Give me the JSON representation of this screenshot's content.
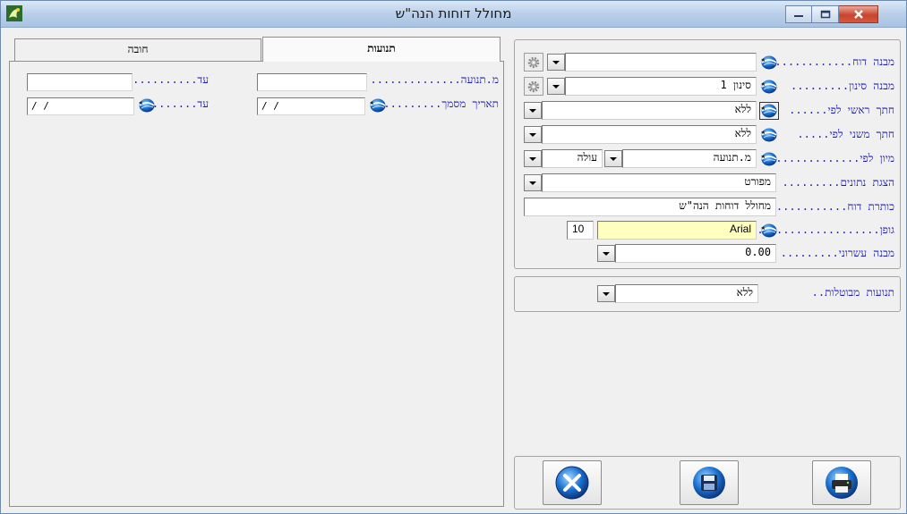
{
  "window": {
    "title": "מחולל דוחות הנה\"ש",
    "icon": "app-logo-icon",
    "controls": [
      "minimize-icon",
      "maximize-icon",
      "close-icon"
    ]
  },
  "left_panel": {
    "tabs": [
      {
        "label": "תנועות",
        "active": true
      },
      {
        "label": "חובה",
        "active": false
      }
    ],
    "fields": {
      "movement_no_label": "מ.תנועה..............",
      "movement_no_value": "",
      "movement_to_label": "עד............",
      "movement_to_value": "",
      "doc_date_label": "תאריך מסמך..........",
      "doc_date_value": "/ /",
      "doc_date_to_label": "עד.......",
      "doc_date_to_value": "/ /"
    }
  },
  "right_panel": {
    "rows": {
      "report_structure_label": "מבנה דוח.............",
      "report_structure_value": "",
      "filter_structure_label": "מבנה סינון.........",
      "filter_structure_value": "סינון 1",
      "primary_section_label": "חתך ראשי לפי......",
      "primary_section_value": "ללא",
      "secondary_section_label": "חתך משני לפי.....",
      "secondary_section_value": "ללא",
      "sort_label": "מיון לפי..............",
      "sort_value": "מ.תנועה",
      "sort_order_value": "עולה",
      "display_label": "הצגת נתונים.........",
      "display_value": "מפורט",
      "report_title_label": "כותרת דוח............",
      "report_title_value": "מחולל דוחות הנה\"ש",
      "font_label": "גופן........................",
      "font_value": "Arial",
      "font_size_value": "10",
      "decimal_label": "מבנה עשרוני.........",
      "decimal_value": "0.00"
    },
    "cancelled": {
      "label": "תנועות מבוטלות..",
      "value": "ללא"
    },
    "toolbar": [
      "printer-icon",
      "save-disk-icon",
      "cancel-x-icon"
    ]
  },
  "colors": {
    "label_blue": "#1f1fb4",
    "font_field_bg": "#ffffc0",
    "titlebar": "#b9cfe9",
    "close_red": "#c8442c"
  }
}
